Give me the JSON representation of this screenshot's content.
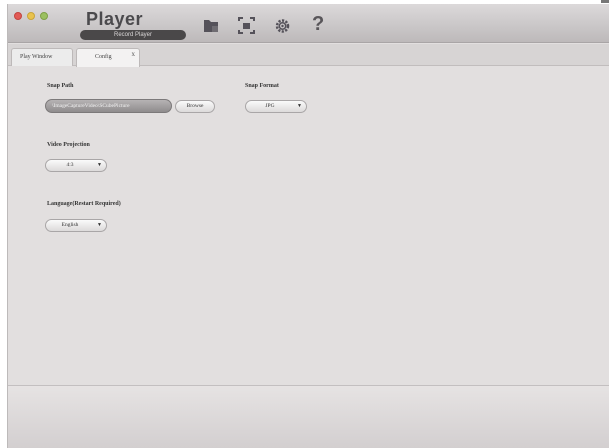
{
  "window": {
    "title": "Player",
    "subtitle": "Record Player"
  },
  "toolbar": {
    "icons": [
      "folder-icon",
      "capture-icon",
      "gear-icon",
      "help-icon"
    ],
    "help_glyph": "?"
  },
  "tabs": [
    {
      "label": "Play Window"
    },
    {
      "label": "Config",
      "close": "x"
    }
  ],
  "config": {
    "snap_path": {
      "label": "Snap Path",
      "value": "\\ImageCaptureVideo\\SCubePicture",
      "browse_label": "Browse"
    },
    "snap_format": {
      "label": "Snap Format",
      "selected": "JPG"
    },
    "video_projection": {
      "label": "Video Projection",
      "selected": "4:3"
    },
    "language": {
      "label": "Language(Restart Required)",
      "selected": "English"
    },
    "dropdown_arrow": "▼"
  },
  "colors": {
    "window_bg": "#e2dfdf",
    "titlebar": "#c9c6c7",
    "close": "#e25a55",
    "minimize": "#e9c34e",
    "maximize": "#9bc060"
  }
}
